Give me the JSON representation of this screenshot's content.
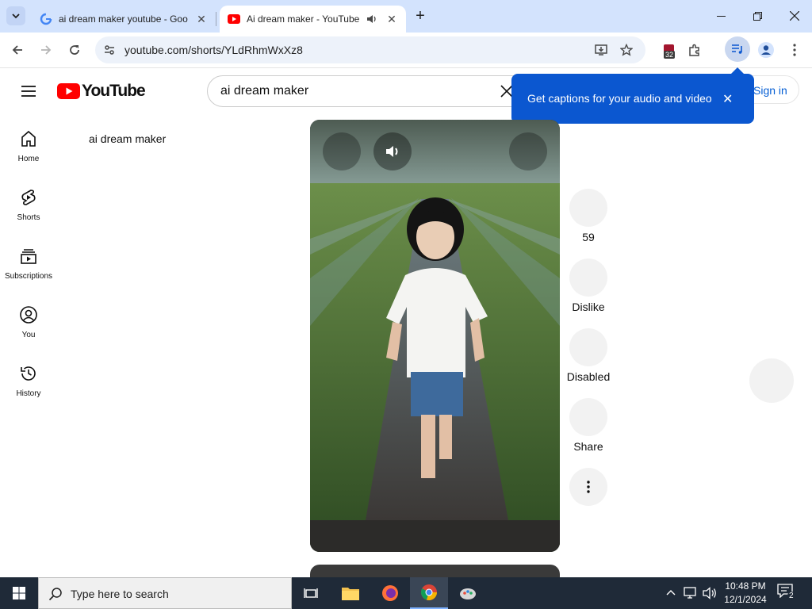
{
  "browser": {
    "tabs": [
      {
        "title": "ai dream maker youtube - Goo",
        "icon": "google-icon",
        "active": false
      },
      {
        "title": "Ai dream maker - YouTube",
        "icon": "youtube-icon",
        "active": true,
        "audio": true
      }
    ],
    "address": "youtube.com/shorts/YLdRhmWxXz8",
    "extensions_badge": "32"
  },
  "youtube": {
    "logo_text": "YouTube",
    "search_query": "ai dream maker",
    "signin_label": "Sign in",
    "nav": [
      {
        "label": "Home",
        "icon": "home-icon"
      },
      {
        "label": "Shorts",
        "icon": "shorts-icon"
      },
      {
        "label": "Subscriptions",
        "icon": "subscriptions-icon"
      },
      {
        "label": "You",
        "icon": "you-icon"
      },
      {
        "label": "History",
        "icon": "history-icon"
      }
    ],
    "channel_title": "ai dream maker",
    "actions": {
      "like_count": "59",
      "dislike_label": "Dislike",
      "comments_label": "Disabled",
      "share_label": "Share"
    },
    "tooltip": {
      "text": "Get captions for your audio and video",
      "close": "✕"
    }
  },
  "taskbar": {
    "search_placeholder": "Type here to search",
    "time": "10:48 PM",
    "date": "12/1/2024",
    "notifications": "2"
  },
  "colors": {
    "youtube_red": "#ff0000",
    "tooltip_blue": "#0b57d0",
    "signin_blue": "#065fd4",
    "tabstrip": "#d3e3fd",
    "taskbar": "#1f2a38"
  }
}
